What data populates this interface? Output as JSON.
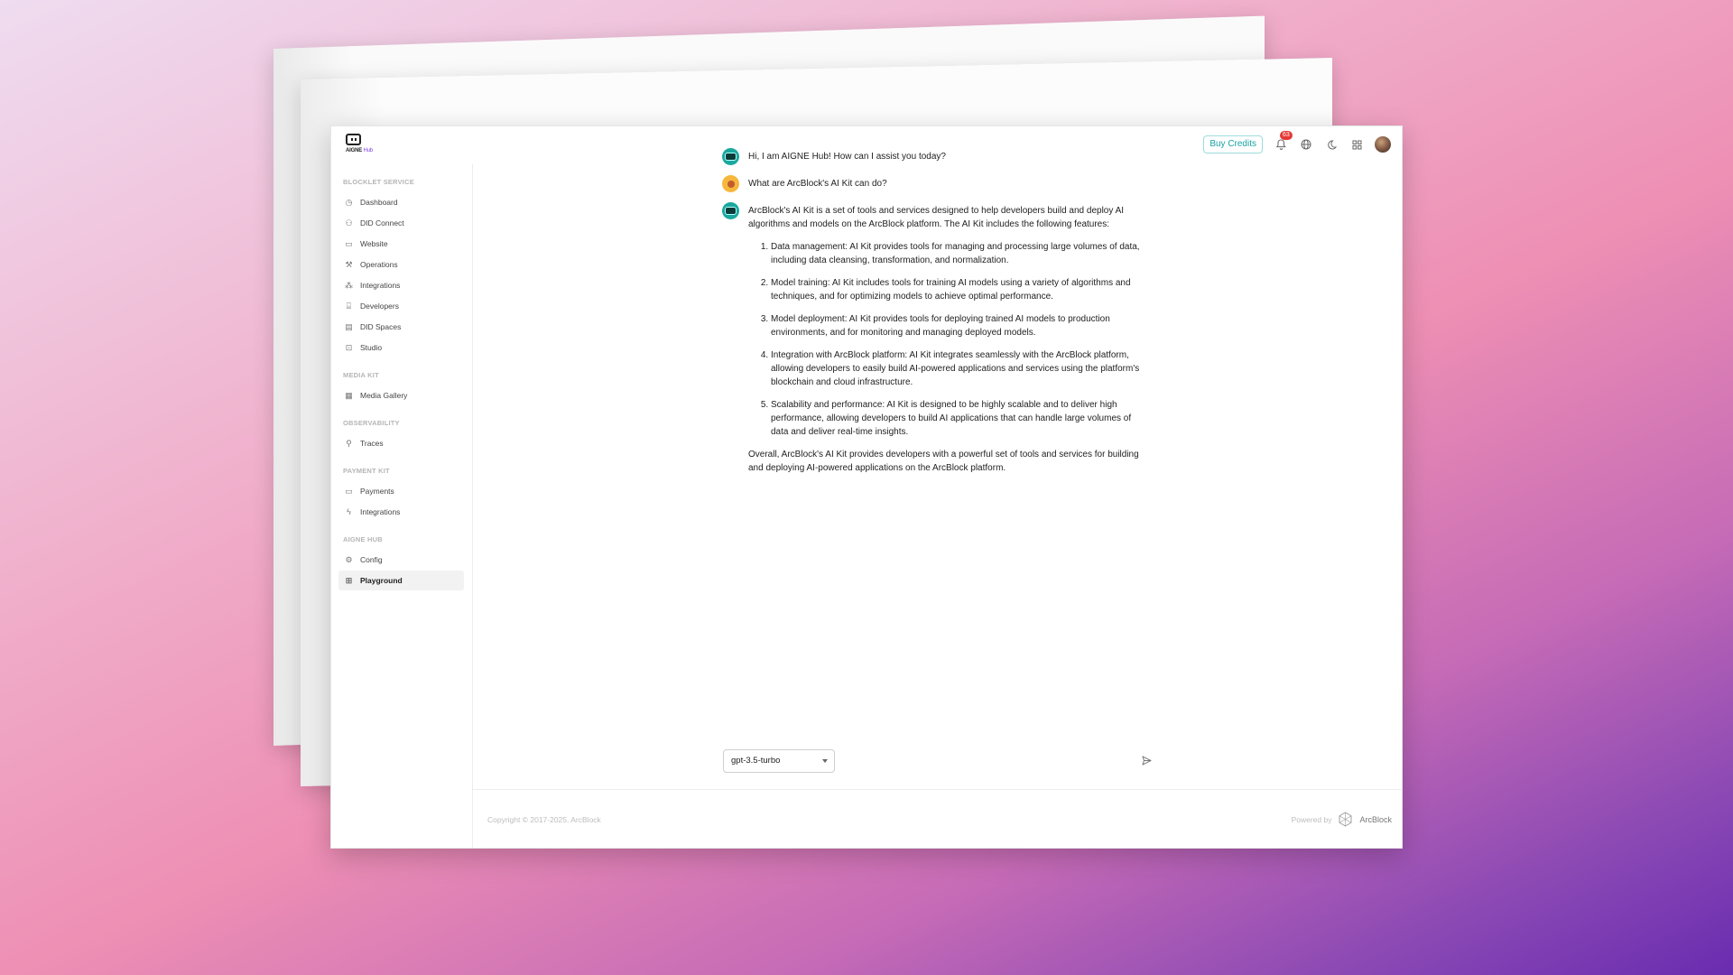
{
  "header": {
    "logo_text": "AIGNE",
    "logo_sub": "Hub",
    "buy_credits": "Buy Credits",
    "notification_count": "63"
  },
  "sidebar": {
    "sections": [
      {
        "title": "BLOCKLET SERVICE",
        "items": [
          {
            "label": "Dashboard",
            "icon": "dashboard-icon"
          },
          {
            "label": "DID Connect",
            "icon": "users-icon"
          },
          {
            "label": "Website",
            "icon": "website-icon"
          },
          {
            "label": "Operations",
            "icon": "wrench-icon"
          },
          {
            "label": "Integrations",
            "icon": "integrations-icon"
          },
          {
            "label": "Developers",
            "icon": "code-icon"
          },
          {
            "label": "DID Spaces",
            "icon": "storage-icon"
          },
          {
            "label": "Studio",
            "icon": "studio-icon"
          }
        ]
      },
      {
        "title": "MEDIA KIT",
        "items": [
          {
            "label": "Media Gallery",
            "icon": "gallery-icon"
          }
        ]
      },
      {
        "title": "OBSERVABILITY",
        "items": [
          {
            "label": "Traces",
            "icon": "traces-icon"
          }
        ]
      },
      {
        "title": "PAYMENT KIT",
        "items": [
          {
            "label": "Payments",
            "icon": "card-icon"
          },
          {
            "label": "Integrations",
            "icon": "bolt-icon"
          }
        ]
      },
      {
        "title": "AIGNE HUB",
        "items": [
          {
            "label": "Config",
            "icon": "gear-icon"
          },
          {
            "label": "Playground",
            "icon": "playground-icon",
            "active": true
          }
        ]
      }
    ]
  },
  "chat": {
    "greeting": "Hi, I am AIGNE Hub! How can I assist you today?",
    "user_question": "What are ArcBlock's AI Kit can do?",
    "answer_intro": "ArcBlock's AI Kit is a set of tools and services designed to help developers build and deploy AI algorithms and models on the ArcBlock platform. The AI Kit includes the following features:",
    "answer_points": [
      "Data management: AI Kit provides tools for managing and processing large volumes of data, including data cleansing, transformation, and normalization.",
      "Model training: AI Kit includes tools for training AI models using a variety of algorithms and techniques, and for optimizing models to achieve optimal performance.",
      "Model deployment: AI Kit provides tools for deploying trained AI models to production environments, and for monitoring and managing deployed models.",
      "Integration with ArcBlock platform: AI Kit integrates seamlessly with the ArcBlock platform, allowing developers to easily build AI-powered applications and services using the platform's blockchain and cloud infrastructure.",
      "Scalability and performance: AI Kit is designed to be highly scalable and to deliver high performance, allowing developers to build AI applications that can handle large volumes of data and deliver real-time insights."
    ],
    "answer_outro": "Overall, ArcBlock's AI Kit provides developers with a powerful set of tools and services for building and deploying AI-powered applications on the ArcBlock platform."
  },
  "input": {
    "model": "gpt-3.5-turbo",
    "placeholder": ""
  },
  "footer": {
    "copyright": "Copyright © 2017-2025. ArcBlock",
    "powered_by": "Powered by",
    "brand": "ArcBlock"
  }
}
